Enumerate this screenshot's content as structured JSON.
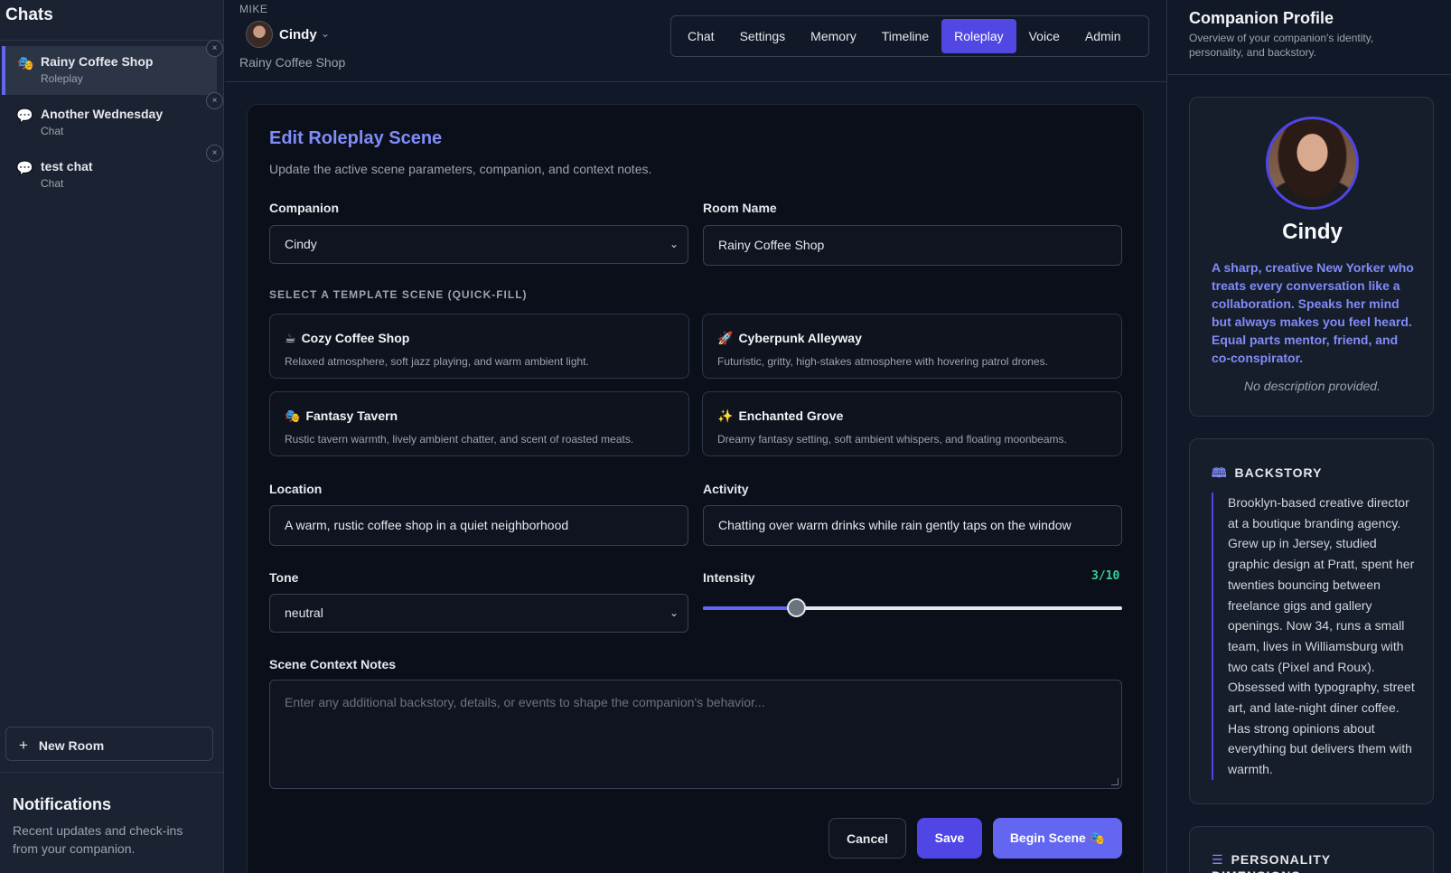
{
  "sidebar": {
    "title": "Chats",
    "chats": [
      {
        "name": "Rainy Coffee Shop",
        "type": "Roleplay",
        "icon": "🎭",
        "icon_name": "theater-masks-icon",
        "active": true
      },
      {
        "name": "Another Wednesday",
        "type": "Chat",
        "icon": "💬",
        "icon_name": "speech-bubble-icon",
        "active": false
      },
      {
        "name": "test chat",
        "type": "Chat",
        "icon": "💬",
        "icon_name": "speech-bubble-icon",
        "active": false
      }
    ],
    "close_glyph": "×",
    "new_room_label": "New Room",
    "new_room_icon": "+",
    "notifications": {
      "title": "Notifications",
      "description": "Recent updates and check-ins from your companion."
    }
  },
  "header": {
    "user": "MIKE",
    "companion": "Cindy",
    "room": "Rainy Coffee Shop",
    "chevron": "⌄",
    "tabs": [
      "Chat",
      "Settings",
      "Memory",
      "Timeline",
      "Roleplay",
      "Voice",
      "Admin"
    ],
    "active_tab": "Roleplay"
  },
  "form": {
    "title": "Edit Roleplay Scene",
    "subtitle": "Update the active scene parameters, companion, and context notes.",
    "companion_label": "Companion",
    "companion_value": "Cindy",
    "room_label": "Room Name",
    "room_value": "Rainy Coffee Shop",
    "templates_label": "SELECT A TEMPLATE SCENE (QUICK-FILL)",
    "templates": [
      {
        "icon": "☕",
        "icon_name": "coffee-icon",
        "name": "Cozy Coffee Shop",
        "desc": "Relaxed atmosphere, soft jazz playing, and warm ambient light."
      },
      {
        "icon": "🚀",
        "icon_name": "rocket-icon",
        "name": "Cyberpunk Alleyway",
        "desc": "Futuristic, gritty, high-stakes atmosphere with hovering patrol drones."
      },
      {
        "icon": "🎭",
        "icon_name": "theater-masks-icon",
        "name": "Fantasy Tavern",
        "desc": "Rustic tavern warmth, lively ambient chatter, and scent of roasted meats."
      },
      {
        "icon": "✨",
        "icon_name": "sparkles-icon",
        "name": "Enchanted Grove",
        "desc": "Dreamy fantasy setting, soft ambient whispers, and floating moonbeams."
      }
    ],
    "location_label": "Location",
    "location_value": "A warm, rustic coffee shop in a quiet neighborhood",
    "activity_label": "Activity",
    "activity_value": "Chatting over warm drinks while rain gently taps on the window",
    "tone_label": "Tone",
    "tone_value": "neutral",
    "intensity_label": "Intensity",
    "intensity_display": "3/10",
    "intensity_value": 3,
    "intensity_max": 10,
    "notes_label": "Scene Context Notes",
    "notes_placeholder": "Enter any additional backstory, details, or events to shape the companion's behavior...",
    "cancel_label": "Cancel",
    "save_label": "Save",
    "begin_label": "Begin Scene 🎭"
  },
  "profile": {
    "title": "Companion Profile",
    "subtitle": "Overview of your companion's identity, personality, and backstory.",
    "name": "Cindy",
    "tagline": "A sharp, creative New Yorker who treats every conversation like a collaboration. Speaks her mind but always makes you feel heard. Equal parts mentor, friend, and co-conspirator.",
    "no_description": "No description provided.",
    "backstory_heading": "BACKSTORY",
    "backstory": "Brooklyn-based creative director at a boutique branding agency. Grew up in Jersey, studied graphic design at Pratt, spent her twenties bouncing between freelance gigs and gallery openings. Now 34, runs a small team, lives in Williamsburg with two cats (Pixel and Roux). Obsessed with typography, street art, and late-night diner coffee. Has strong opinions about everything but delivers them with warmth.",
    "personality_heading": "PERSONALITY DIMENSIONS"
  },
  "colors": {
    "accent": "#6366f1",
    "accent_text": "#818cf8",
    "intensity_value": "#34d399",
    "background": "#111827"
  }
}
